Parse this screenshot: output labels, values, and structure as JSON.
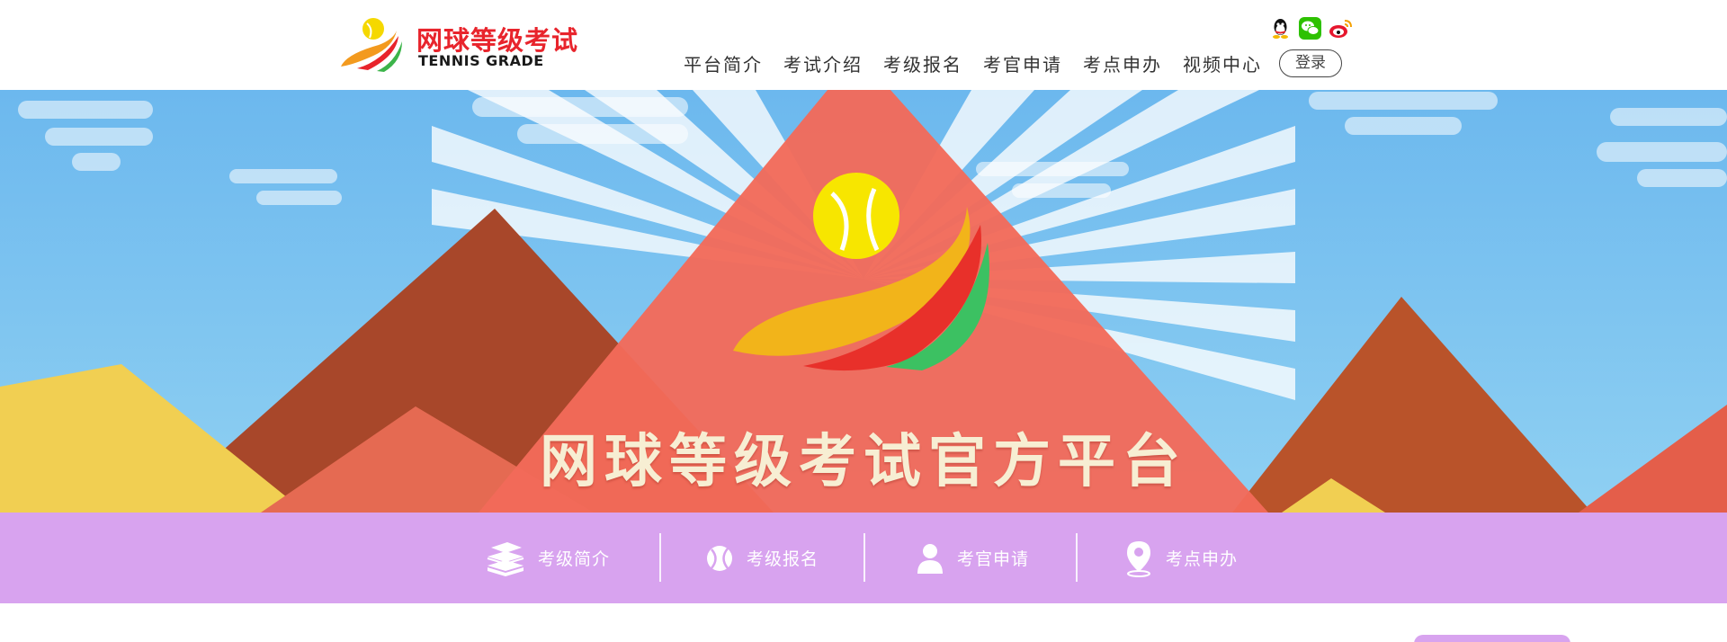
{
  "header": {
    "logo_cn": "网球等级考试",
    "logo_en": "TENNIS GRADE",
    "nav": [
      {
        "label": "平台简介"
      },
      {
        "label": "考试介绍"
      },
      {
        "label": "考级报名"
      },
      {
        "label": "考官申请"
      },
      {
        "label": "考点申办"
      },
      {
        "label": "视频中心"
      }
    ],
    "social_icons": [
      "qq-icon",
      "wechat-icon",
      "weibo-icon"
    ],
    "login_label": "登录"
  },
  "banner": {
    "title": "网球等级考试官方平台"
  },
  "quickbar": {
    "items": [
      {
        "label": "考级简介",
        "icon": "books-icon"
      },
      {
        "label": "考级报名",
        "icon": "tennis-ball-icon"
      },
      {
        "label": "考官申请",
        "icon": "person-icon"
      },
      {
        "label": "考点申办",
        "icon": "location-pin-icon"
      }
    ]
  },
  "colors": {
    "logo_red": "#e8242c",
    "sky_blue": "#7cc3f0",
    "peak_red": "#f26a5a",
    "quickbar_purple": "#d8a3ef",
    "title_cream": "#f7eed3"
  }
}
